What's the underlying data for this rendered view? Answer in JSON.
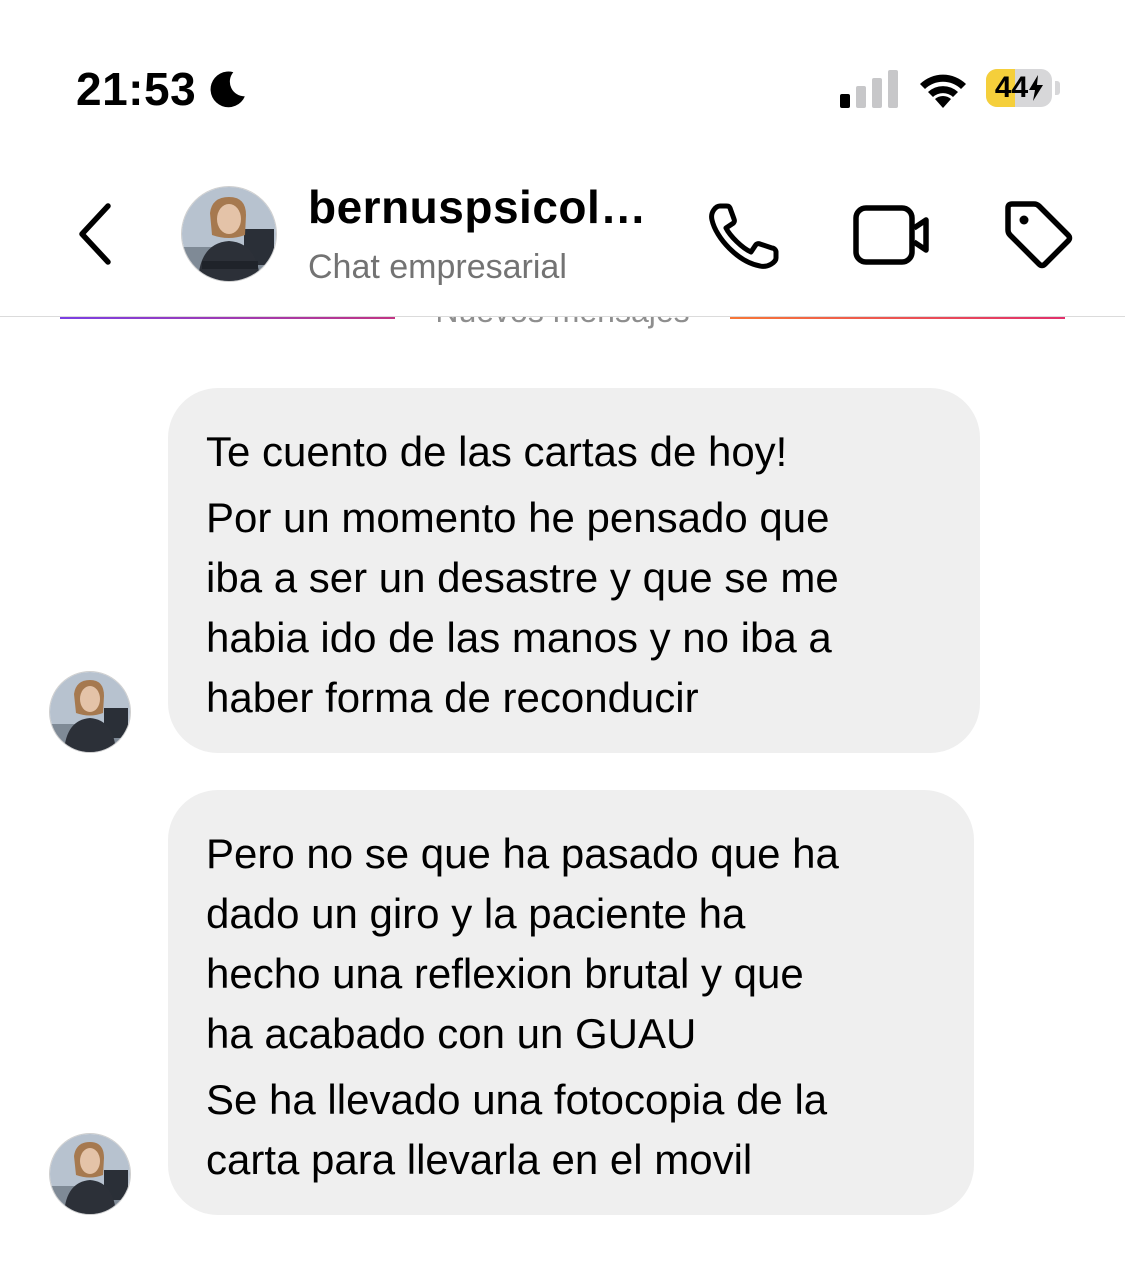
{
  "status_bar": {
    "time": "21:53",
    "battery_percent": "44",
    "battery_level": 0.44,
    "battery_color": "#f5cf3b",
    "signal_bars_active": 1,
    "icons": [
      "moon-icon",
      "signal-icon",
      "wifi-icon",
      "battery-icon",
      "charging-bolt-icon"
    ]
  },
  "header": {
    "name": "bernuspsicol…",
    "subtitle": "Chat empresarial",
    "icons": [
      "back-chevron-icon",
      "phone-call-icon",
      "video-camera-icon",
      "tag-icon"
    ]
  },
  "divider": {
    "label": "Nuevos mensajes"
  },
  "messages": [
    {
      "sender": "incoming",
      "paragraphs": [
        [
          "Te cuento de las cartas de hoy!"
        ],
        [
          "Por un momento he pensado que",
          "iba a ser un desastre y que se me",
          "habia ido de las manos y no iba a",
          "haber forma de reconducir"
        ]
      ]
    },
    {
      "sender": "incoming",
      "paragraphs": [
        [
          "Pero no se que ha pasado que ha",
          "dado un giro y la paciente ha",
          "hecho una reflexion brutal y que",
          "ha acabado con un GUAU"
        ],
        [
          "Se ha llevado una fotocopia de la",
          "carta para llevarla en el movil"
        ]
      ]
    }
  ]
}
